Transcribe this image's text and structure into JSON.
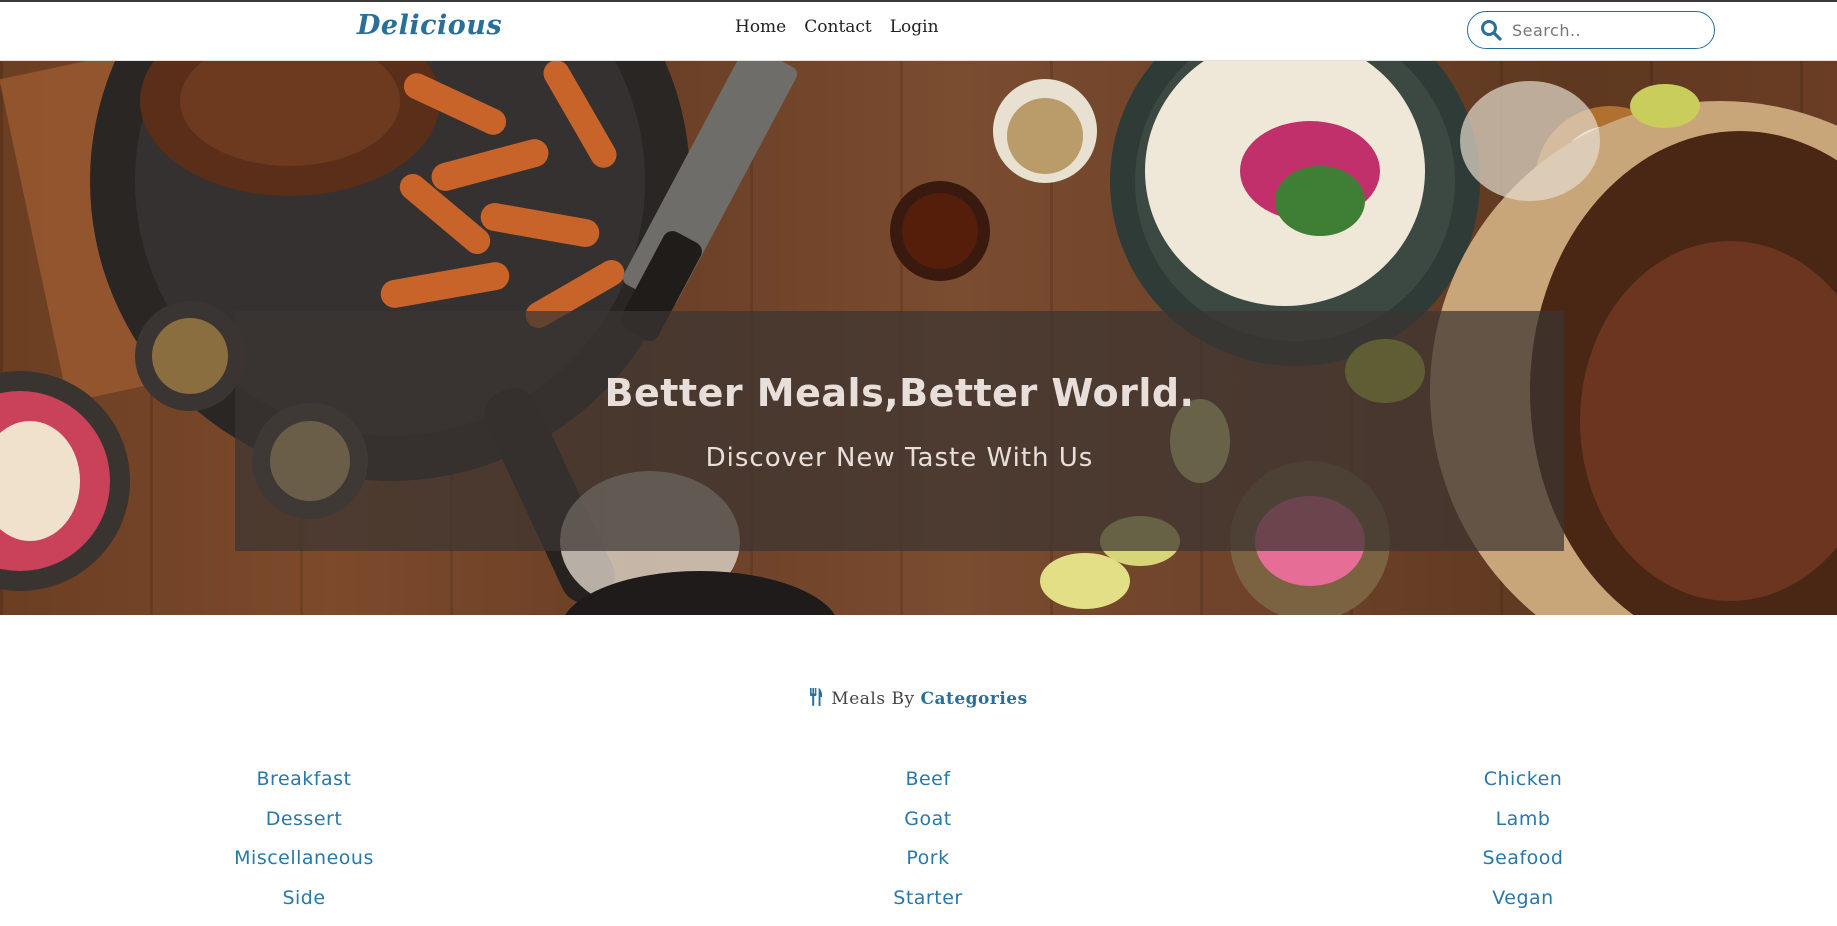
{
  "navbar": {
    "brand": "Delicious",
    "links": [
      "Home",
      "Contact",
      "Login"
    ],
    "search_placeholder": "Search.."
  },
  "hero": {
    "title": "Better Meals,Better World.",
    "subtitle": "Discover New Taste With Us"
  },
  "categories": {
    "heading_prefix": "Meals By",
    "heading_accent": "Categories",
    "columns": [
      [
        "Breakfast",
        "Dessert",
        "Miscellaneous",
        "Side"
      ],
      [
        "Beef",
        "Goat",
        "Pork",
        "Starter"
      ],
      [
        "Chicken",
        "Lamb",
        "Seafood",
        "Vegan"
      ]
    ]
  },
  "colors": {
    "accent": "#2a6f9a",
    "link": "#2a78a8",
    "overlay": "#3c3432"
  },
  "icons": {
    "search": "search-icon",
    "fork_knife": "cutlery-icon"
  }
}
